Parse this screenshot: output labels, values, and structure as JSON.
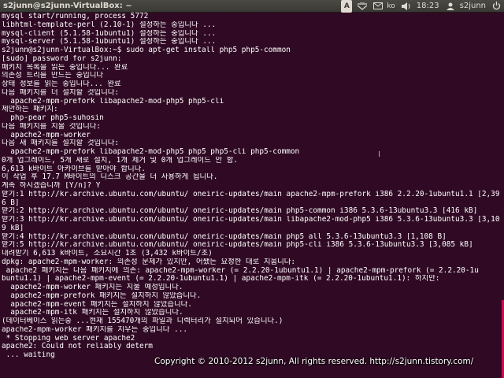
{
  "window": {
    "title": "s2junn@s2junn-VirtualBox: ~"
  },
  "tray": {
    "indicator_letter": "A",
    "keyboard_layout": "ko",
    "clock": "18:23",
    "user": "s2junn"
  },
  "terminal": {
    "lines": [
      "mysql start/running, process 5772",
      "libhtml-template-perl (2.10-1) 설정하는 중입니다 ...",
      "mysql-client (5.1.58-1ubuntu1) 설정하는 중입니다 ...",
      "mysql-server (5.1.58-1ubuntu1) 설정하는 중입니다 ...",
      "s2junn@s2junn-VirtualBox:~$ sudo apt-get install php5 php5-common",
      "[sudo] password for s2junn:",
      "패키지 목록을 읽는 중입니다... 완료",
      "의존성 트리를 만드는 중입니다",
      "상태 정보를 읽는 중입니다... 완료",
      "다음 패키지를 더 설치할 것입니다:",
      "  apache2-mpm-prefork libapache2-mod-php5 php5-cli",
      "제안하는 패키지:",
      "  php-pear php5-suhosin",
      "다음 패키지를 지울 것입니다:",
      "  apache2-mpm-worker",
      "다음 새 패키지를 설치할 것입니다:",
      "  apache2-mpm-prefork libapache2-mod-php5 php5 php5-cli php5-common",
      "0개 업그레이드, 5개 새로 설치, 1개 제거 및 0개 업그레이드 안 함.",
      "6,613 k바이트 아카이브를 받아야 합니다.",
      "이 작업 후 17.7 M바이트의 디스크 공간을 더 사용하게 됩니다.",
      "계속 하시겠습니까 [Y/n]? Y",
      "받기:1 http://kr.archive.ubuntu.com/ubuntu/ oneiric-updates/main apache2-mpm-prefork i386 2.2.20-1ubuntu1.1 [2,39",
      "6 B]",
      "받기:2 http://kr.archive.ubuntu.com/ubuntu/ oneiric-updates/main php5-common i386 5.3.6-13ubuntu3.3 [416 kB]",
      "받기:3 http://kr.archive.ubuntu.com/ubuntu/ oneiric-updates/main libapache2-mod-php5 i386 5.3.6-13ubuntu3.3 [3,10",
      "9 kB]",
      "받기:4 http://kr.archive.ubuntu.com/ubuntu/ oneiric-updates/main php5 all 5.3.6-13ubuntu3.3 [1,108 B]",
      "받기:5 http://kr.archive.ubuntu.com/ubuntu/ oneiric-updates/main php5-cli i386 5.3.6-13ubuntu3.3 [3,085 kB]",
      "내려받기 6,613 k바이트, 소요시간 1초 (3,432 k바이트/초)",
      "dpkg: apache2-mpm-worker: 의존성 문제가 있지만, 어쨌든 요청한 대로 지웁니다:",
      " apache2 패키지는 다음 패키지에 의존: apache2-mpm-worker (= 2.2.20-1ubuntu1.1) | apache2-mpm-prefork (= 2.2.20-1u",
      "buntu1.1) | apache2-mpm-event (= 2.2.20-1ubuntu1.1) | apache2-mpm-itk (= 2.2.20-1ubuntu1.1): 하지만:",
      "  apache2-mpm-worker 패키지는 지울 예정입니다.",
      "  apache2-mpm-prefork 패키지는 설치하지 않았습니다.",
      "  apache2-mpm-event 패키지는 설치하지 않았습니다.",
      "  apache2-mpm-itk 패키지는 설치하지 않았습니다.",
      "(데이터베이스 읽는중 ...현재 155470개의 파일과 디렉터리가 설치되어 있습니다.)",
      "apache2-mpm-worker 패키지를 지우는 중입니다 ...",
      " * Stopping web server apache2",
      "apache2: Could not reliably determ",
      " ... waiting"
    ]
  },
  "watermark": {
    "text": "Copyright © 2010-2012 s2junn, All rights reserved. http://s2junn.tistory.com/"
  },
  "icons": {
    "network": "network-icon",
    "mail": "mail-icon",
    "volume": "volume-icon",
    "power": "power-icon",
    "cursor": "ibeam-cursor-icon"
  },
  "colors": {
    "terminal_bg": "#300a24",
    "panel_bg": "#3a3935",
    "text": "#ffffff",
    "scroll_accent": "#c01050"
  }
}
